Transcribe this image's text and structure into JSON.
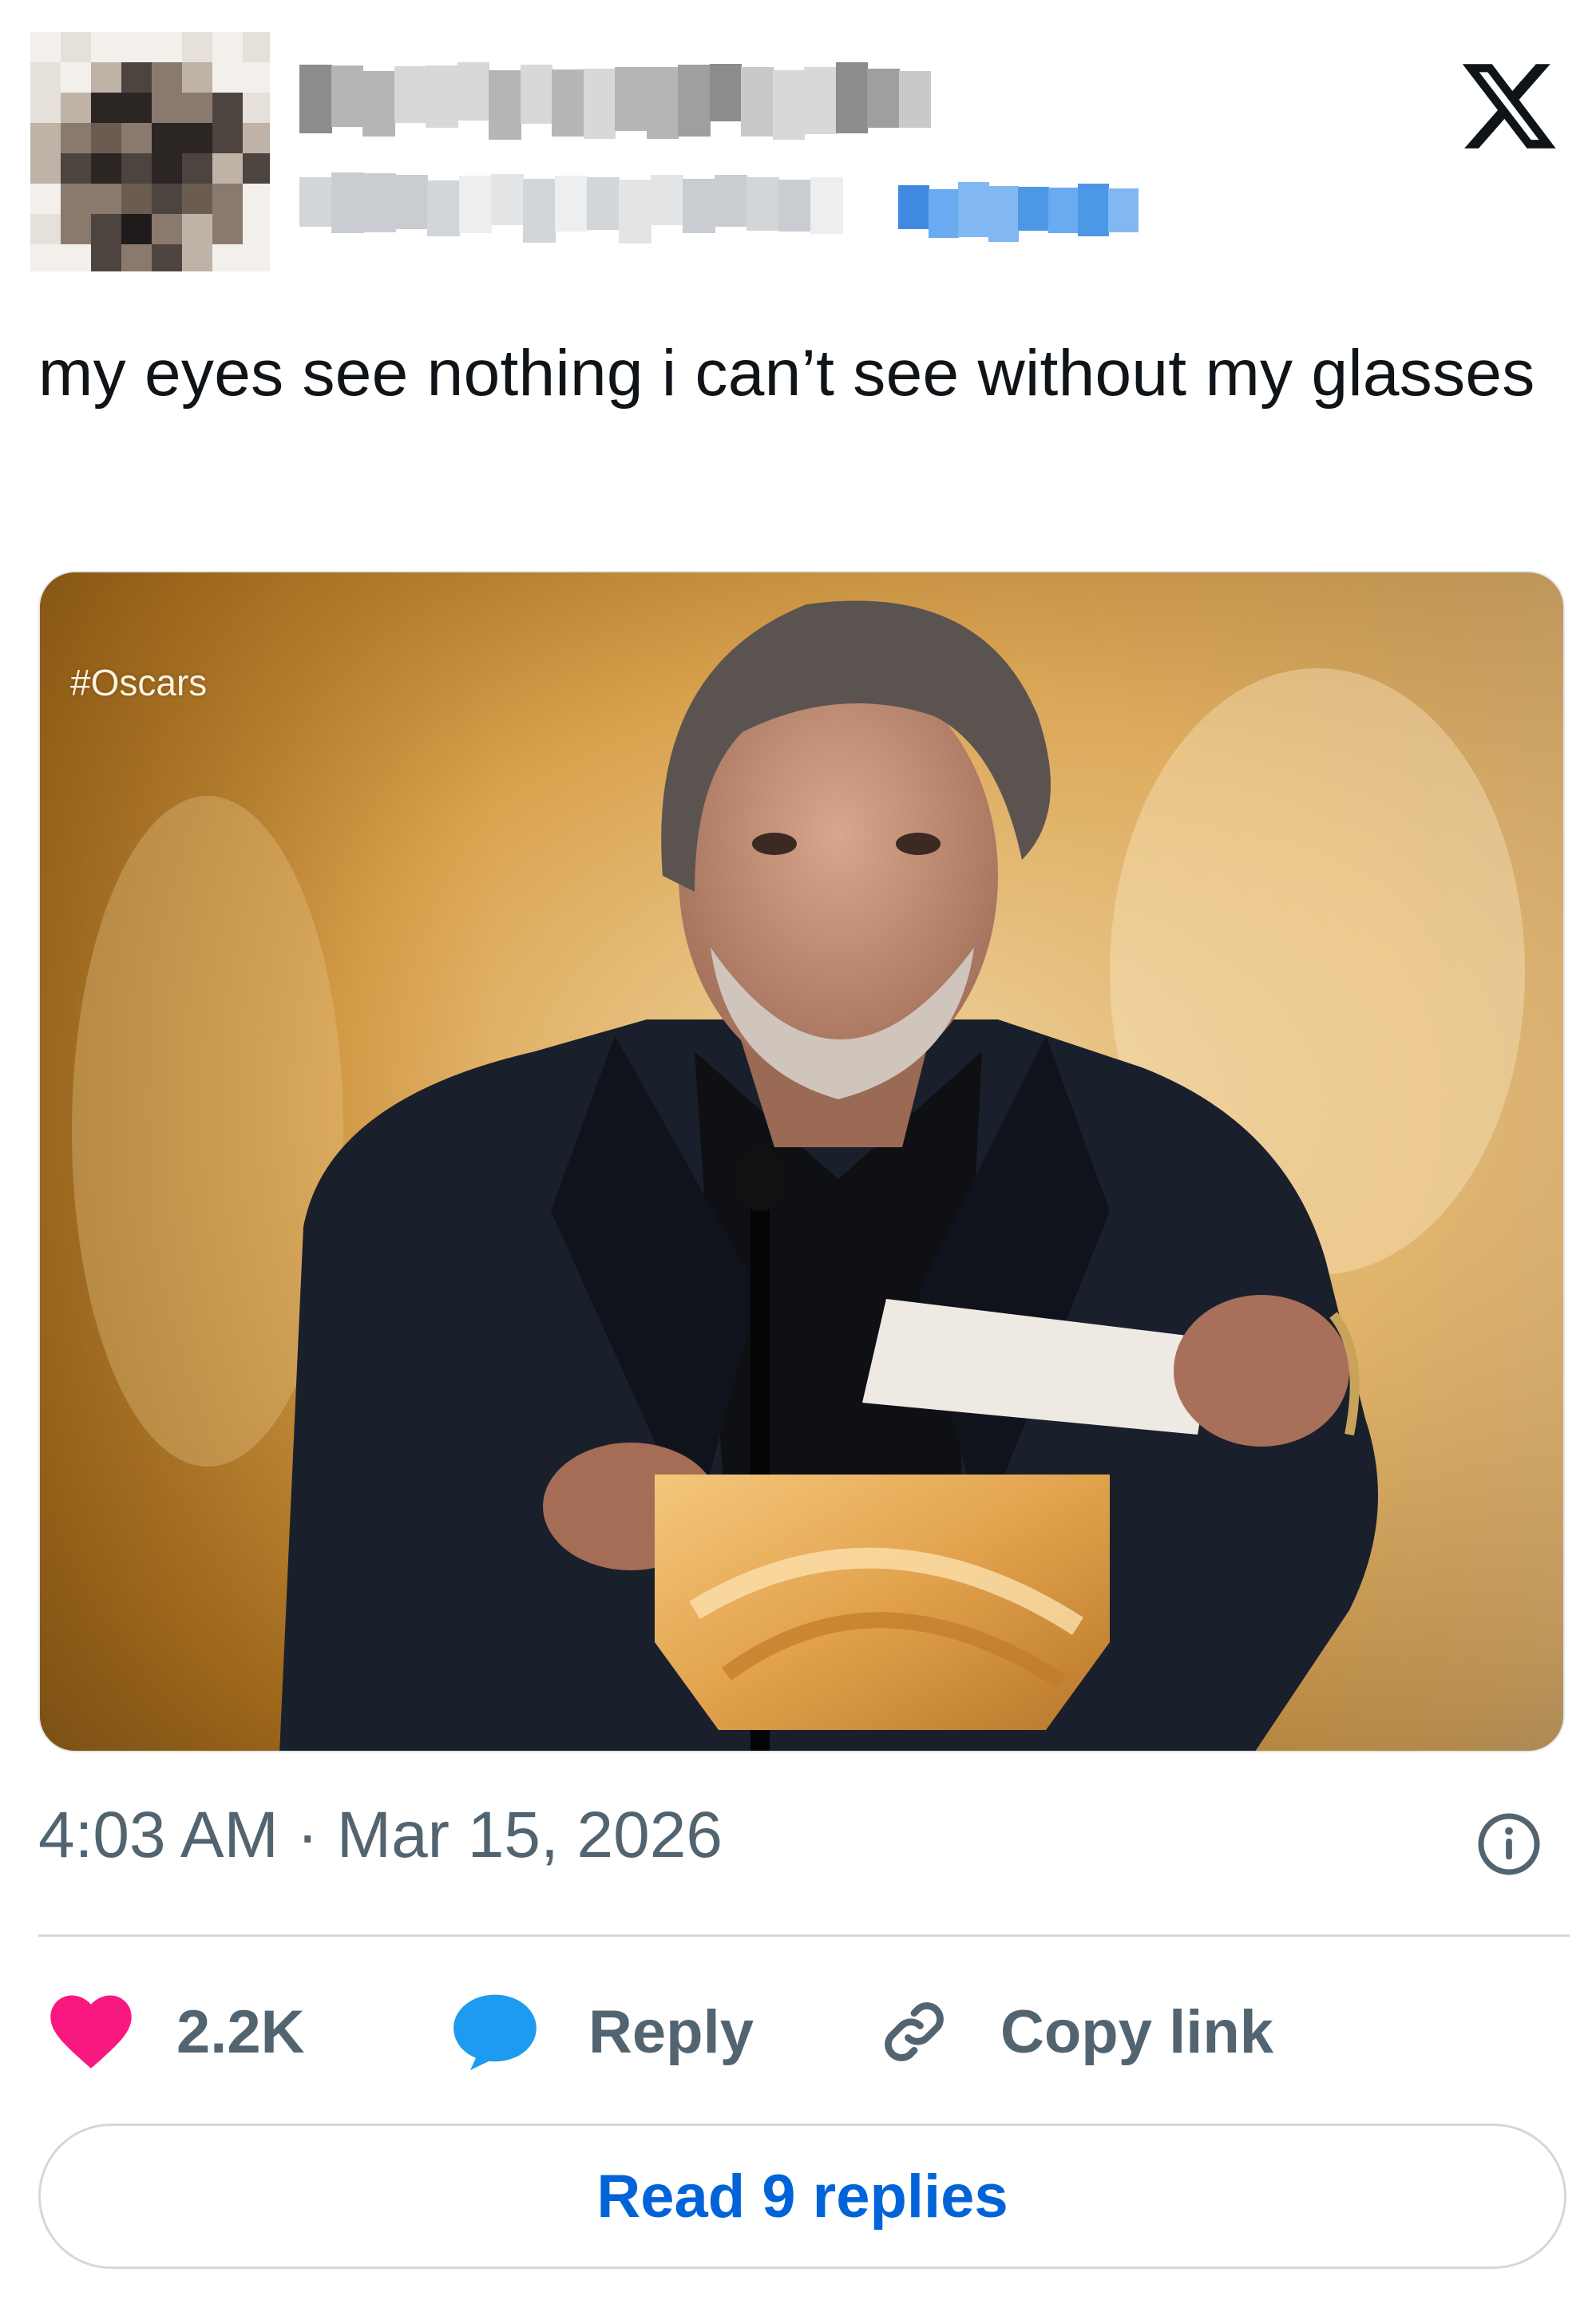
{
  "header": {
    "logo_icon": "x-logo-icon"
  },
  "tweet": {
    "text": "my eyes see nothing i can’t see without my glasses",
    "media": {
      "overlay_text": "#Oscars"
    },
    "time": "4:03 AM",
    "separator": "·",
    "date": "Mar 15, 2026"
  },
  "actions": {
    "likes_count": "2.2K",
    "reply_label": "Reply",
    "copy_link_label": "Copy link",
    "read_replies_label": "Read 9 replies"
  },
  "colors": {
    "like": "#f91880",
    "reply": "#1d9bf0",
    "link": "#0063d8",
    "muted": "#536471"
  }
}
